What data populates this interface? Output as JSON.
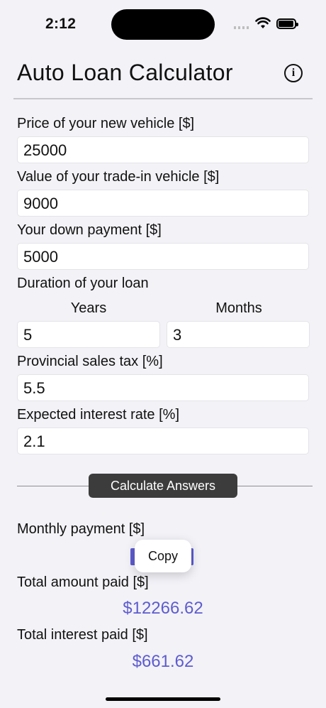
{
  "status": {
    "time": "2:12"
  },
  "header": {
    "title": "Auto Loan Calculator",
    "info_icon": "info-circle-icon"
  },
  "form": {
    "price_label": "Price of your new vehicle [$]",
    "price_value": "25000",
    "tradein_label": "Value of your trade-in vehicle [$]",
    "tradein_value": "9000",
    "down_label": "Your down payment [$]",
    "down_value": "5000",
    "duration_label": "Duration of your loan",
    "years_label": "Years",
    "years_value": "5",
    "months_label": "Months",
    "months_value": "3",
    "tax_label": "Provincial sales tax [%]",
    "tax_value": "5.5",
    "rate_label": "Expected interest rate [%]",
    "rate_value": "2.1"
  },
  "actions": {
    "calculate_label": "Calculate Answers"
  },
  "results": {
    "monthly_label": "Monthly payment [$]",
    "copy_label": "Copy",
    "total_paid_label": "Total amount paid [$]",
    "total_paid_value": "$12266.62",
    "total_interest_label": "Total interest paid [$]",
    "total_interest_value": "$661.62"
  },
  "colors": {
    "accent": "#5e5ccf",
    "button_bg": "#3c3c3c",
    "background": "#f2f2f7"
  }
}
